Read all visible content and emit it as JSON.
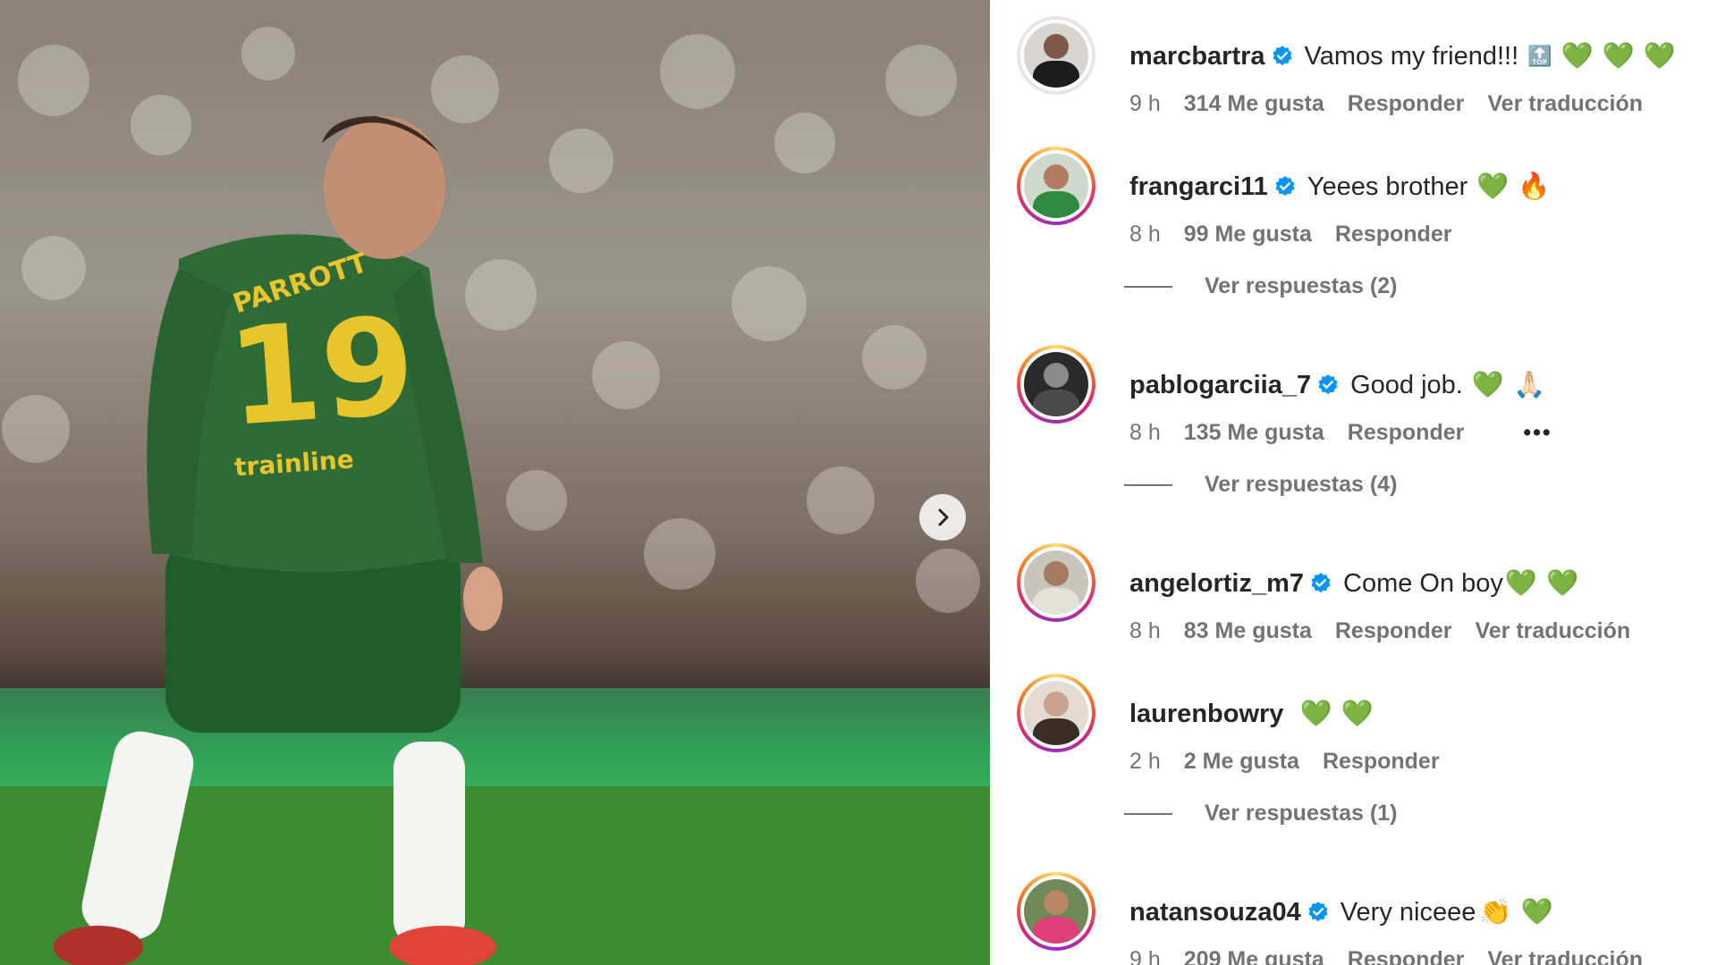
{
  "post": {
    "jersey_name": "PARROTT",
    "jersey_number": "19",
    "sponsor": "trainline"
  },
  "icons": {
    "next": "chevron-right-icon",
    "verified": "verified-badge-icon",
    "more": "more-options-icon"
  },
  "colors": {
    "heart_green": "#20b25a",
    "verified_blue": "#0095f6",
    "muted_text": "#737373"
  },
  "comments": [
    {
      "username": "marcbartra",
      "verified": true,
      "text": "Vamos my friend!!!",
      "emojis": [
        "🔝",
        "💚",
        "💚",
        "💚"
      ],
      "time": "9 h",
      "likes": "314 Me gusta",
      "reply": "Responder",
      "translate": "Ver traducción"
    },
    {
      "username": "frangarci11",
      "verified": true,
      "text": "Yeees brother",
      "emojis": [
        "💚",
        "🔥"
      ],
      "time": "8 h",
      "likes": "99 Me gusta",
      "reply": "Responder",
      "replies": "Ver respuestas (2)"
    },
    {
      "username": "pablogarciia_7",
      "verified": true,
      "text": "Good job.",
      "emojis": [
        "💚",
        "🙏🏻"
      ],
      "time": "8 h",
      "likes": "135 Me gusta",
      "reply": "Responder",
      "more": "•••",
      "replies": "Ver respuestas (4)"
    },
    {
      "username": "angelortiz_m7",
      "verified": true,
      "text": "Come On boy",
      "emojis": [
        "💚",
        "💚"
      ],
      "time": "8 h",
      "likes": "83 Me gusta",
      "reply": "Responder",
      "translate": "Ver traducción"
    },
    {
      "username": "laurenbowry",
      "verified": false,
      "text": "",
      "emojis": [
        "💚",
        "💚"
      ],
      "time": "2 h",
      "likes": "2 Me gusta",
      "reply": "Responder",
      "replies": "Ver respuestas (1)"
    },
    {
      "username": "natansouza04",
      "verified": true,
      "text": "Very niceee",
      "emojis": [
        "👏",
        "💚"
      ],
      "time": "9 h",
      "likes": "209 Me gusta",
      "reply": "Responder",
      "translate": "Ver traducción"
    }
  ]
}
